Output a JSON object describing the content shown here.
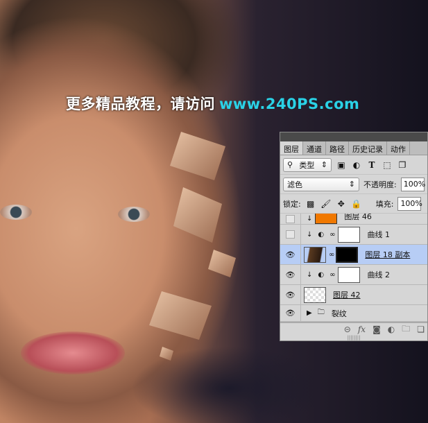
{
  "watermark": {
    "cn": "更多精品教程，请访问",
    "url": "www.240PS.com"
  },
  "panel": {
    "tabs": [
      "图层",
      "通道",
      "路径",
      "历史记录",
      "动作"
    ],
    "filter": {
      "label": "类型",
      "icons": [
        "image-filter-icon",
        "adjustment-filter-icon",
        "type-filter-icon",
        "shape-filter-icon",
        "smart-object-filter-icon"
      ]
    },
    "blend_mode": "滤色",
    "opacity_label": "不透明度:",
    "opacity": "100%",
    "lock_label": "锁定:",
    "fill_label": "填充:",
    "fill": "100%",
    "layers": [
      {
        "name": "图层 46",
        "visible": false,
        "type": "color-fill",
        "color": "#f07800"
      },
      {
        "name": "曲线 1",
        "visible": false,
        "type": "curves"
      },
      {
        "name": "图层 18 副本",
        "visible": true,
        "type": "masked",
        "selected": true
      },
      {
        "name": "曲线 2",
        "visible": true,
        "type": "curves"
      },
      {
        "name": "图层 42",
        "visible": true,
        "type": "pixel"
      },
      {
        "name": "裂纹",
        "visible": true,
        "type": "group"
      }
    ]
  }
}
